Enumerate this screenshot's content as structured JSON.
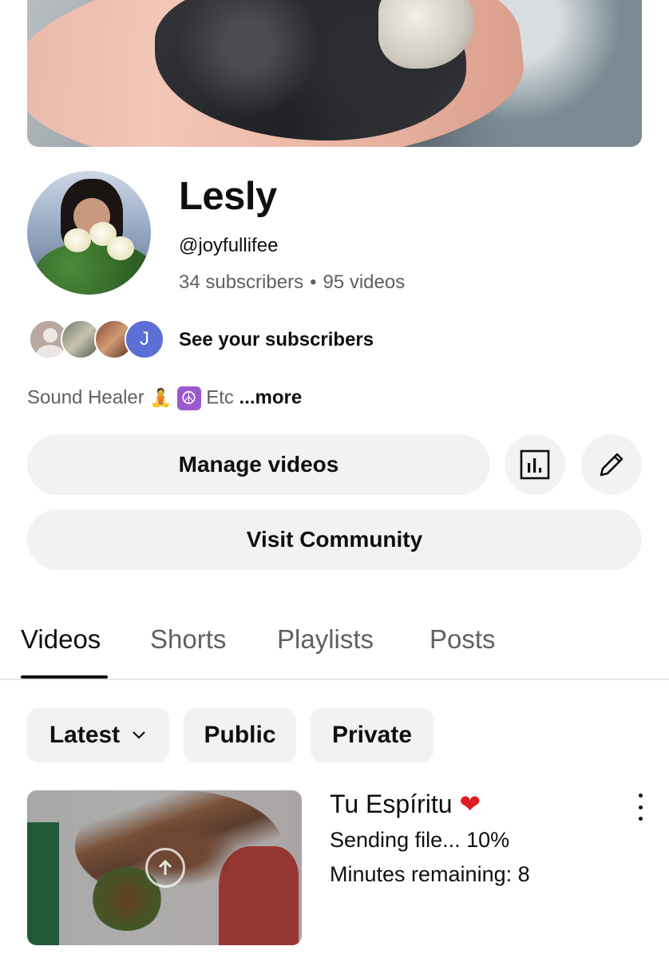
{
  "channel": {
    "name": "Lesly",
    "handle": "@joyfullifee",
    "subscribers": "34 subscribers",
    "separator": "•",
    "videos": "95 videos",
    "see_subscribers": "See your subscribers",
    "subscriber_avatar_initial": "J",
    "bio_text": "Sound Healer",
    "bio_emoji_1": "🧘",
    "bio_emoji_2": "☮",
    "bio_etc": "Etc",
    "bio_more": "...more"
  },
  "actions": {
    "manage_videos": "Manage videos",
    "visit_community": "Visit Community",
    "analytics_icon": "analytics-icon",
    "edit_icon": "pencil-icon"
  },
  "tabs": [
    {
      "label": "Videos",
      "active": true
    },
    {
      "label": "Shorts",
      "active": false
    },
    {
      "label": "Playlists",
      "active": false
    },
    {
      "label": "Posts",
      "active": false
    }
  ],
  "filters": {
    "latest": "Latest",
    "public": "Public",
    "private": "Private"
  },
  "video": {
    "title": "Tu Espíritu",
    "title_emoji": "❤",
    "status": "Sending file... 10%",
    "progress_percent": 10,
    "remaining": "Minutes remaining: 8"
  },
  "colors": {
    "text": "#0f0f0f",
    "secondary_text": "#606060",
    "button_bg": "#f2f2f2",
    "subscriber_j": "#5b6fd6",
    "heart": "#e01b24"
  }
}
